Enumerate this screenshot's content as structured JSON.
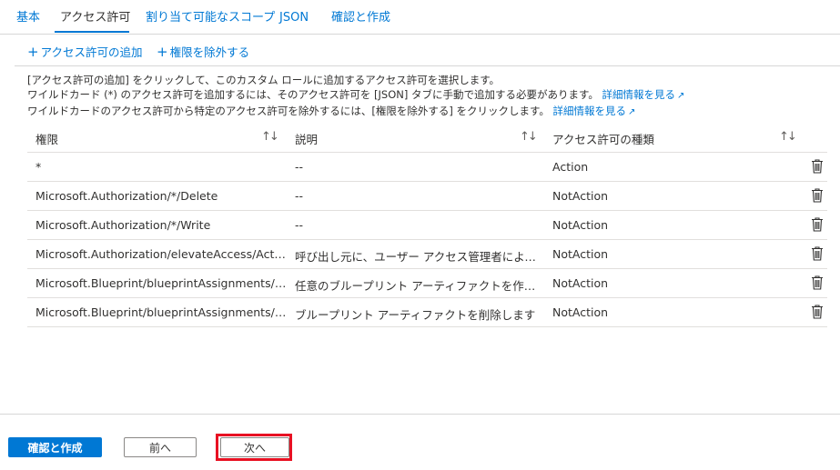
{
  "tabs": [
    {
      "label": "基本"
    },
    {
      "label": "アクセス許可"
    },
    {
      "label": "割り当て可能なスコープ"
    },
    {
      "label": "JSON"
    },
    {
      "label": "確認と作成"
    }
  ],
  "commands": {
    "add_permission": "アクセス許可の追加",
    "exclude_permission": "権限を除外する"
  },
  "description": {
    "line1": "[アクセス許可の追加] をクリックして、このカスタム ロールに追加するアクセス許可を選択します。",
    "line2": "ワイルドカード (*) のアクセス許可を追加するには、そのアクセス許可を [JSON] タブに手動で追加する必要があります。",
    "line3": "ワイルドカードのアクセス許可から特定のアクセス許可を除外するには、[権限を除外する] をクリックします。",
    "learn_more": "詳細情報を見る"
  },
  "table": {
    "headers": [
      "権限",
      "説明",
      "アクセス許可の種類"
    ],
    "rows": [
      {
        "permission": "*",
        "description": "--",
        "type": "Action"
      },
      {
        "permission": "Microsoft.Authorization/*/Delete",
        "description": "--",
        "type": "NotAction"
      },
      {
        "permission": "Microsoft.Authorization/*/Write",
        "description": "--",
        "type": "NotAction"
      },
      {
        "permission": "Microsoft.Authorization/elevateAccess/Action",
        "description": "呼び出し元に、ユーザー アクセス管理者によるテナン...",
        "type": "NotAction"
      },
      {
        "permission": "Microsoft.Blueprint/blueprintAssignments/write",
        "description": "任意のブループリント アーティファクトを作成または更...",
        "type": "NotAction"
      },
      {
        "permission": "Microsoft.Blueprint/blueprintAssignments/del...",
        "description": "ブループリント アーティファクトを削除します",
        "type": "NotAction"
      }
    ]
  },
  "footer": {
    "review_create": "確認と作成",
    "previous": "前へ",
    "next": "次へ"
  },
  "colors": {
    "accent": "#0078d4",
    "highlight": "#e81123"
  }
}
